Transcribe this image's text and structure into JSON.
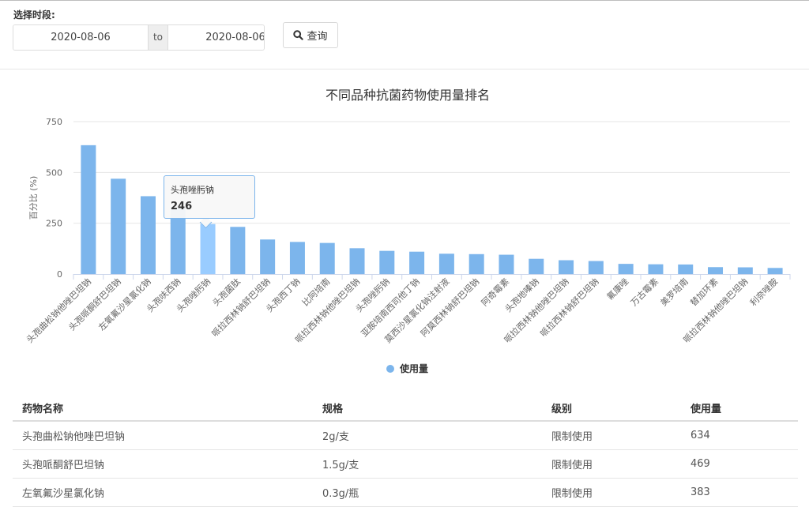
{
  "filter": {
    "label": "选择时段:",
    "start_date": "2020-08-06",
    "separator": "to",
    "end_date": "2020-08-06",
    "query_label": "查询",
    "query_icon": "search-icon"
  },
  "chart_data": {
    "type": "bar",
    "title": "不同品种抗菌药物使用量排名",
    "ylabel": "百分比 (%)",
    "xlabel": "",
    "ylim": [
      0,
      750
    ],
    "yticks": [
      0,
      250,
      500,
      750
    ],
    "grid": true,
    "legend_position": "bottom-center",
    "colors": {
      "bar": "#7cb5ec",
      "bar_highlight": "#99ccff",
      "grid": "#e6e6e6",
      "axis": "#ccd6eb"
    },
    "categories": [
      "头孢曲松钠他唑巴坦钠",
      "头孢哌酮舒巴坦钠",
      "左氧氟沙星氯化钠",
      "头孢呋西钠",
      "头孢唑肟钠",
      "头孢菌肽",
      "哌拉西林钠舒巴坦钠",
      "头孢西丁钠",
      "比阿培南",
      "哌拉西林钠他唑巴坦钠",
      "头孢唑肟钠",
      "亚胺培南西司他丁钠",
      "莫西沙星氯化钠注射液",
      "阿莫西林钠舒巴坦钠",
      "阿奇霉素",
      "头孢地嗪钠",
      "哌拉西林钠他唑巴坦钠",
      "哌拉西林钠舒巴坦钠",
      "氟康唑",
      "万古霉素",
      "美罗培南",
      "替加环素",
      "哌拉西林钠他唑巴坦钠",
      "利奈唑胺"
    ],
    "series": [
      {
        "name": "使用量",
        "values": [
          634,
          469,
          383,
          327,
          246,
          232,
          170,
          158,
          153,
          127,
          114,
          110,
          100,
          98,
          95,
          75,
          68,
          64,
          50,
          48,
          47,
          34,
          33,
          30
        ]
      }
    ],
    "tooltip": {
      "category": "头孢唑肟钠",
      "value": "246",
      "index": 4
    }
  },
  "table": {
    "headers": [
      "药物名称",
      "规格",
      "级别",
      "使用量"
    ],
    "rows": [
      [
        "头孢曲松钠他唑巴坦钠",
        "2g/支",
        "限制使用",
        "634"
      ],
      [
        "头孢哌酮舒巴坦钠",
        "1.5g/支",
        "限制使用",
        "469"
      ],
      [
        "左氧氟沙星氯化钠",
        "0.3g/瓶",
        "限制使用",
        "383"
      ]
    ]
  }
}
